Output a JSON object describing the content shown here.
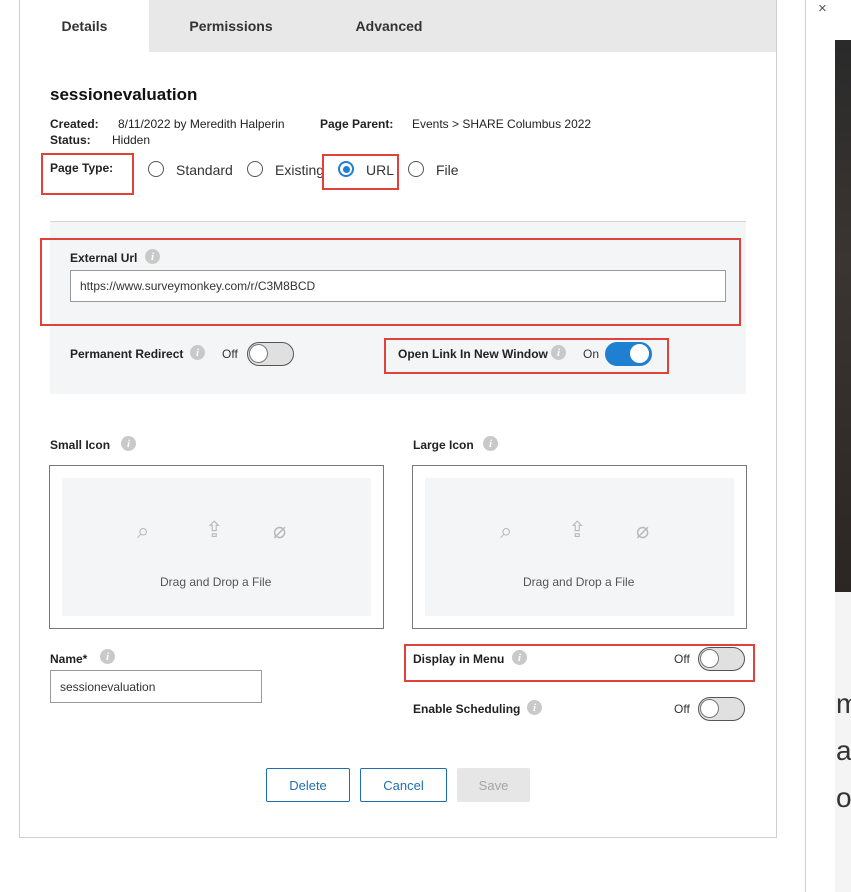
{
  "tabs": [
    {
      "label": "Details",
      "active": true
    },
    {
      "label": "Permissions",
      "active": false
    },
    {
      "label": "Advanced",
      "active": false
    }
  ],
  "page": {
    "title": "sessionevaluation",
    "created_label": "Created:",
    "created_value": "8/11/2022 by Meredith Halperin",
    "parent_label": "Page Parent:",
    "parent_value": "Events > SHARE Columbus 2022",
    "status_label": "Status:",
    "status_value": "Hidden"
  },
  "page_type": {
    "label": "Page Type:",
    "options": [
      "Standard",
      "Existing",
      "URL",
      "File"
    ],
    "selected": "URL"
  },
  "external_url": {
    "label": "External Url",
    "value": "https://www.surveymonkey.com/r/C3M8BCD"
  },
  "permanent_redirect": {
    "label": "Permanent Redirect",
    "state": "Off"
  },
  "open_new_window": {
    "label": "Open Link In New Window",
    "state": "On"
  },
  "small_icon": {
    "label": "Small Icon",
    "drop_text": "Drag and Drop a File"
  },
  "large_icon": {
    "label": "Large Icon",
    "drop_text": "Drag and Drop a File"
  },
  "name": {
    "label": "Name*",
    "value": "sessionevaluation"
  },
  "display_in_menu": {
    "label": "Display in Menu",
    "state": "Off"
  },
  "enable_scheduling": {
    "label": "Enable Scheduling",
    "state": "Off"
  },
  "buttons": {
    "delete": "Delete",
    "cancel": "Cancel",
    "save": "Save"
  },
  "background": {
    "close_glyph": "×",
    "letters": [
      "m",
      "a",
      "o"
    ]
  },
  "colors": {
    "accent": "#1f7fd1",
    "highlight": "#e0413b",
    "button_outline": "#1f6fae"
  }
}
